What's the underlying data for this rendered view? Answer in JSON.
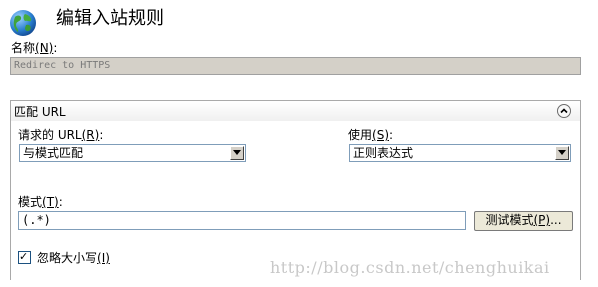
{
  "dialog": {
    "title": "编辑入站规则"
  },
  "name": {
    "label_text": "名称",
    "accel": "(N)",
    "colon": ":",
    "value": "Redirec to HTTPS"
  },
  "match_group": {
    "header": "匹配 URL",
    "requested_url": {
      "label_text": "请求的 URL",
      "accel": "(R)",
      "colon": ":",
      "selected": "与模式匹配"
    },
    "using": {
      "label_text": "使用",
      "accel": "(S)",
      "colon": ":",
      "selected": "正则表达式"
    },
    "pattern": {
      "label_text": "模式",
      "accel": "(T)",
      "colon": ":",
      "value": "(.*)"
    },
    "test_button": {
      "label_text": "测试模式",
      "accel": "(P)",
      "suffix": "..."
    },
    "ignore_case": {
      "checked": true,
      "check_glyph": "✓",
      "label_text": "忽略大小写",
      "accel": "(I)"
    }
  },
  "watermark": "http://blog.csdn.net/chenghuikai",
  "colors": {
    "field_disabled_bg": "#d4d0c8",
    "select_border": "#7f9db9",
    "group_border": "#a9a9a9"
  },
  "icons": {
    "app": "globe-icon",
    "collapse": "chevron-up-icon",
    "dropdown": "triangle-down-icon"
  }
}
